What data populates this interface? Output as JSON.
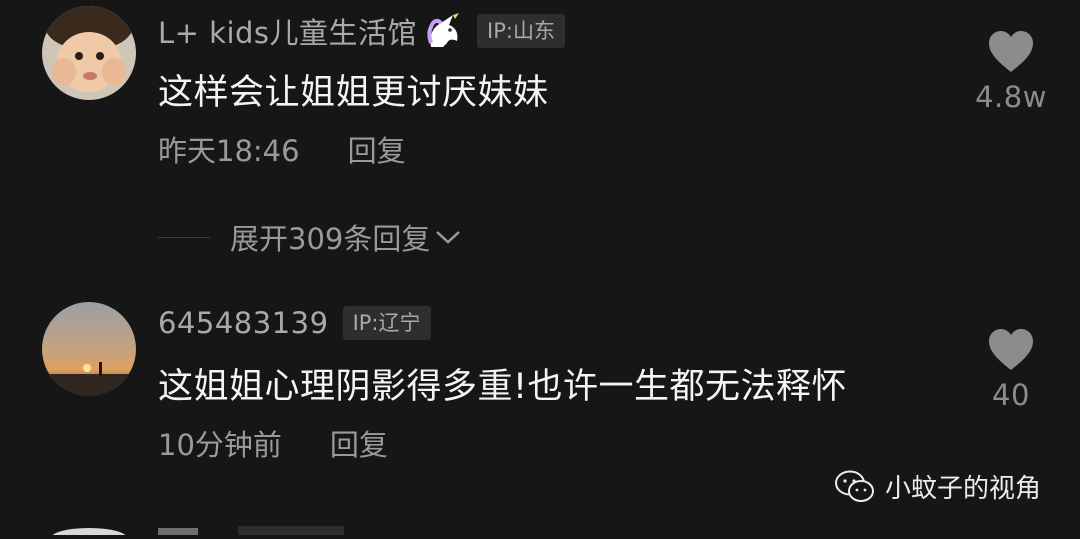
{
  "comments": [
    {
      "username": "L+  kids儿童生活馆",
      "emoji_icon": "unicorn-icon",
      "ip": "IP:山东",
      "text": "这样会让姐姐更讨厌妹妹",
      "time": "昨天18:46",
      "reply_label": "回复",
      "likes": "4.8w"
    },
    {
      "username": "645483139",
      "ip": "IP:辽宁",
      "text": "这姐姐心理阴影得多重!也许一生都无法释怀",
      "time": "10分钟前",
      "reply_label": "回复",
      "likes": "40"
    }
  ],
  "expand_replies": "展开309条回复",
  "watermark": "小蚊子的视角",
  "icons": {
    "like": "heart-icon",
    "expand": "chevron-down-icon",
    "watermark": "wechat-icon"
  },
  "colors": {
    "background": "#161616",
    "text": "#f4f4f4",
    "secondary": "#9a9a9a",
    "badge": "#2e2e2e"
  }
}
